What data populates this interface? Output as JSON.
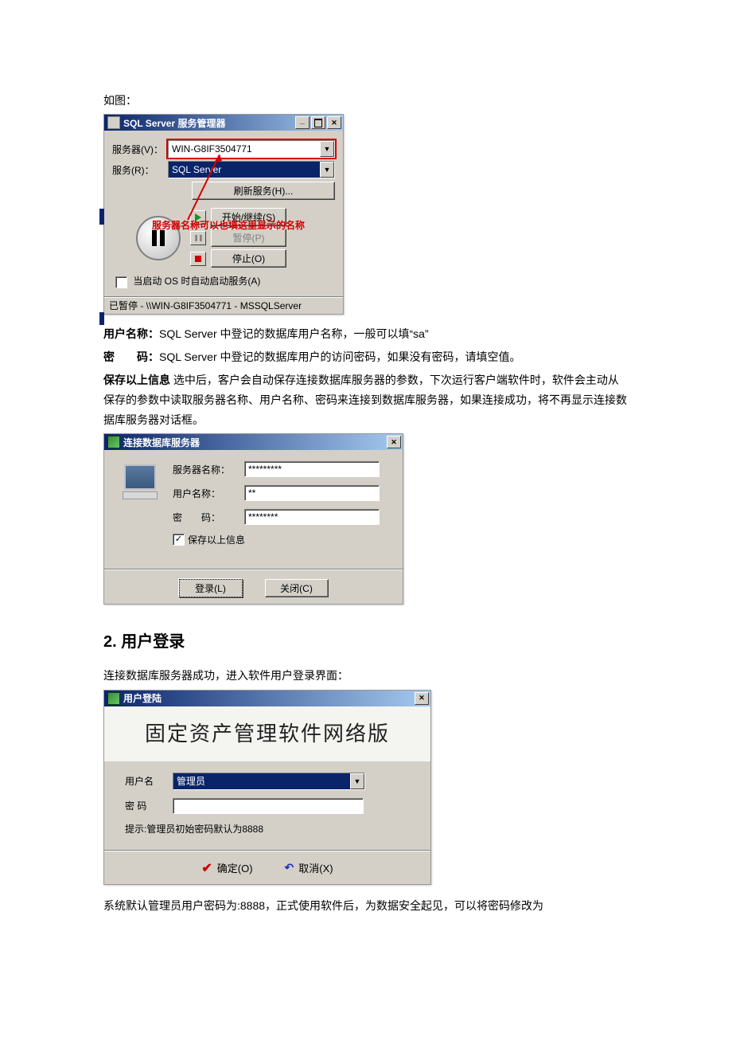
{
  "intro": {
    "fig_label": "如图："
  },
  "dlg1": {
    "title": "SQL Server 服务管理器",
    "server_label": "服务器(V)：",
    "server_value": "WIN-G8IF3504771",
    "service_label": "服务(R)：",
    "service_value": "SQL Server",
    "refresh_btn": "刷新服务(H)...",
    "start_btn": "开始/继续(S)",
    "pause_btn": "暂停(P)",
    "stop_btn": "停止(O)",
    "autostart_label": "当启动 OS 时自动启动服务(A)",
    "status": "已暂停 - \\\\WIN-G8IF3504771 - MSSQLServer",
    "annotation": "服务器名称可以也填这里显示的名称"
  },
  "body_text": {
    "user_label": "用户名称：",
    "user_desc": "SQL Server 中登记的数据库用户名称，一般可以填“sa”",
    "pwd_label_a": "密",
    "pwd_label_b": "码：",
    "pwd_desc": "SQL Server 中登记的数据库用户的访问密码，如果没有密码，请填空值。",
    "save_label": "保存以上信息",
    "save_desc": "选中后，客户会自动保存连接数据库服务器的参数，下次运行客户端软件时，软件会主动从保存的参数中读取服务器名称、用户名称、密码来连接到数据库服务器，如果连接成功，将不再显示连接数据库服务器对话框。"
  },
  "dlg2": {
    "title": "连接数据库服务器",
    "server_label": "服务器名称：",
    "server_value": "*********",
    "user_label": "用户名称：",
    "user_value": "**",
    "pwd_label_a": "密",
    "pwd_label_b": "码：",
    "pwd_value": "********",
    "save_checkbox": "保存以上信息",
    "login_btn": "登录(L)",
    "close_btn": "关闭(C)"
  },
  "section2": {
    "heading": "2. 用户登录",
    "lead": "连接数据库服务器成功，进入软件用户登录界面："
  },
  "dlg3": {
    "title": "用户登陆",
    "banner": "固定资产管理软件网络版",
    "user_label": "用户名",
    "user_value": "管理员",
    "pwd_label": "密 码",
    "pwd_value": "",
    "hint": "提示:管理员初始密码默认为8888",
    "ok_btn": "确定(O)",
    "cancel_btn": "取消(X)"
  },
  "trailing": {
    "text": "系统默认管理员用户密码为:8888，正式使用软件后，为数据安全起见，可以将密码修改为"
  }
}
